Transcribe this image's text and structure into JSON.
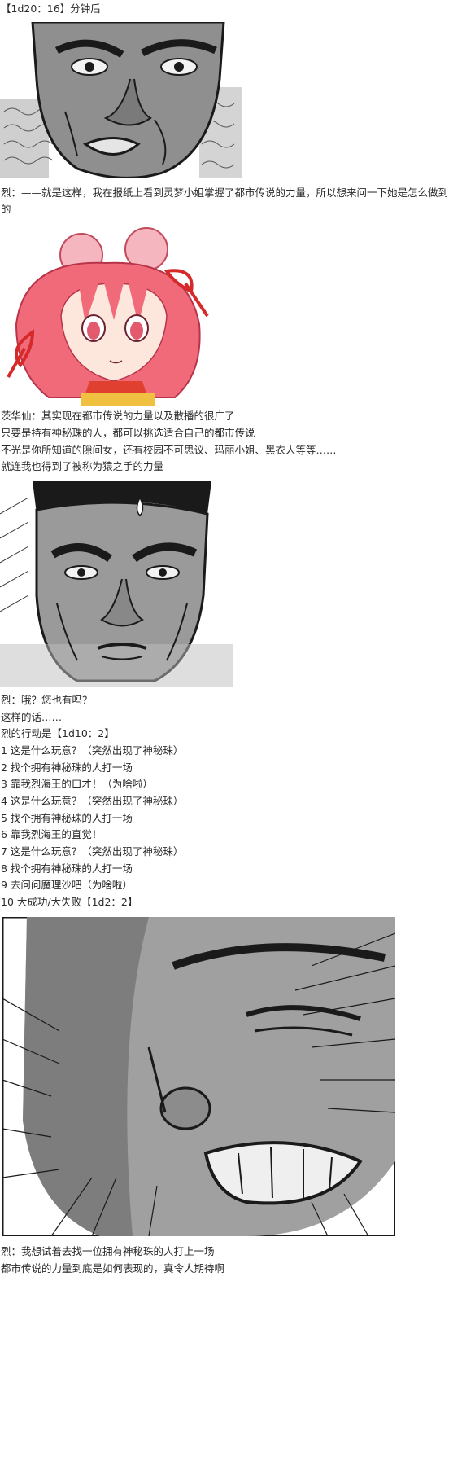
{
  "header": {
    "time_note": "【1d20：16】分钟后"
  },
  "dialogue_1": {
    "text": "烈：——就是这样，我在报纸上看到灵梦小姐掌握了都市传说的力量，所以想来问一下她是怎么做到的"
  },
  "dialogue_2": {
    "lines": [
      "茨华仙：其实现在都市传说的力量以及散播的很广了",
      "只要是持有神秘珠的人，都可以挑选适合自己的都市传说",
      "不光是你所知道的隙间女，还有校园不可思议、玛丽小姐、黑衣人等等……",
      "就连我也得到了被称为猿之手的力量"
    ]
  },
  "dialogue_3": {
    "lines": [
      "烈：哦？您也有吗？",
      "这样的话……",
      "烈的行动是【1d10：2】"
    ]
  },
  "options": [
    "1 这是什么玩意？（突然出现了神秘珠）",
    "2 找个拥有神秘珠的人打一场",
    "3 靠我烈海王的口才！（为啥啦）",
    "4 这是什么玩意？（突然出现了神秘珠）",
    "5 找个拥有神秘珠的人打一场",
    "6 靠我烈海王的直觉！",
    "7 这是什么玩意？（突然出现了神秘珠）",
    "8 找个拥有神秘珠的人打一场",
    "9 去问问魔理沙吧（为啥啦）",
    "10 大成功/大失败【1d2：2】"
  ],
  "dialogue_4": {
    "lines": [
      "烈：我想试着去找一位拥有神秘珠的人打上一场",
      "都市传说的力量到底是如何表现的，真令人期待啊"
    ]
  },
  "colors": {
    "text": "#2b2b2b",
    "manga_ink": "#1a1a1a",
    "manga_gray": "#8a8a8a",
    "anime_hair": "#f06a7a",
    "anime_ribbon": "#d62a2a"
  }
}
